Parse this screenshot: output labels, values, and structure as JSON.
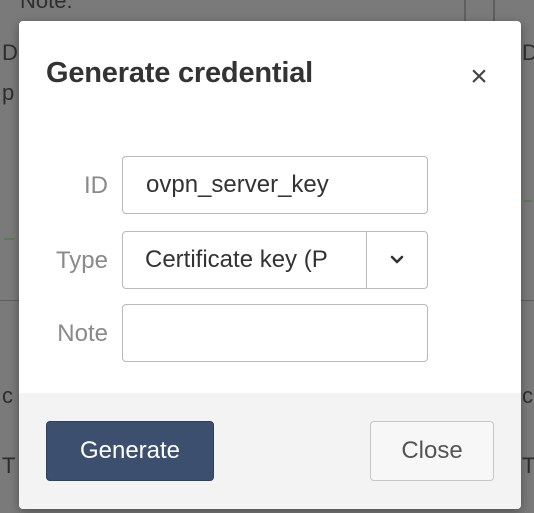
{
  "modal": {
    "title": "Generate credential",
    "close_symbol": "×"
  },
  "form": {
    "id": {
      "label": "ID",
      "value": "ovpn_server_key"
    },
    "type": {
      "label": "Type",
      "selected": "Certificate key (P"
    },
    "note": {
      "label": "Note",
      "value": ""
    }
  },
  "footer": {
    "generate_label": "Generate",
    "close_label": "Close"
  },
  "colors": {
    "primary_button": "#3c4f6e",
    "footer_bg": "#f3f3f3",
    "input_border": "#b9b9b9"
  },
  "icons": {
    "close": "close-icon",
    "dropdown": "chevron-down-icon"
  }
}
